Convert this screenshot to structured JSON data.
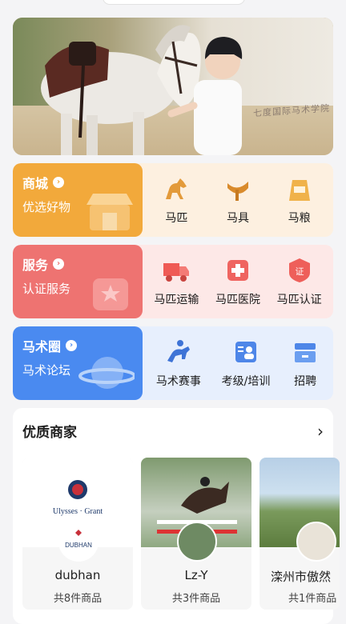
{
  "banner": {
    "sign_text": "七度国际马术学院"
  },
  "sections": [
    {
      "title": "商城",
      "subtitle": "优选好物",
      "items": [
        {
          "label": "马匹",
          "icon": "horse-icon"
        },
        {
          "label": "马具",
          "icon": "saddle-icon"
        },
        {
          "label": "马粮",
          "icon": "feed-bag-icon"
        }
      ]
    },
    {
      "title": "服务",
      "subtitle": "认证服务",
      "items": [
        {
          "label": "马匹运输",
          "icon": "truck-icon"
        },
        {
          "label": "马匹医院",
          "icon": "hospital-icon"
        },
        {
          "label": "马匹认证",
          "icon": "certification-icon"
        }
      ]
    },
    {
      "title": "马术圈",
      "subtitle": "马术论坛",
      "items": [
        {
          "label": "马术赛事",
          "icon": "rider-icon"
        },
        {
          "label": "考级/培训",
          "icon": "training-icon"
        },
        {
          "label": "招聘",
          "icon": "recruit-icon"
        }
      ]
    }
  ],
  "merchants": {
    "title": "优质商家",
    "cards": [
      {
        "name": "dubhan",
        "count": "共8件商品",
        "brand_text": "Ulysses · Grant",
        "logo_text": "DUBHAN"
      },
      {
        "name": "Lz-Y",
        "count": "共3件商品"
      },
      {
        "name": "滦州市傲然",
        "count": "共1件商品"
      }
    ]
  },
  "colors": {
    "shop": "#f2a93b",
    "service": "#ee7371",
    "forum": "#4a8af0"
  }
}
